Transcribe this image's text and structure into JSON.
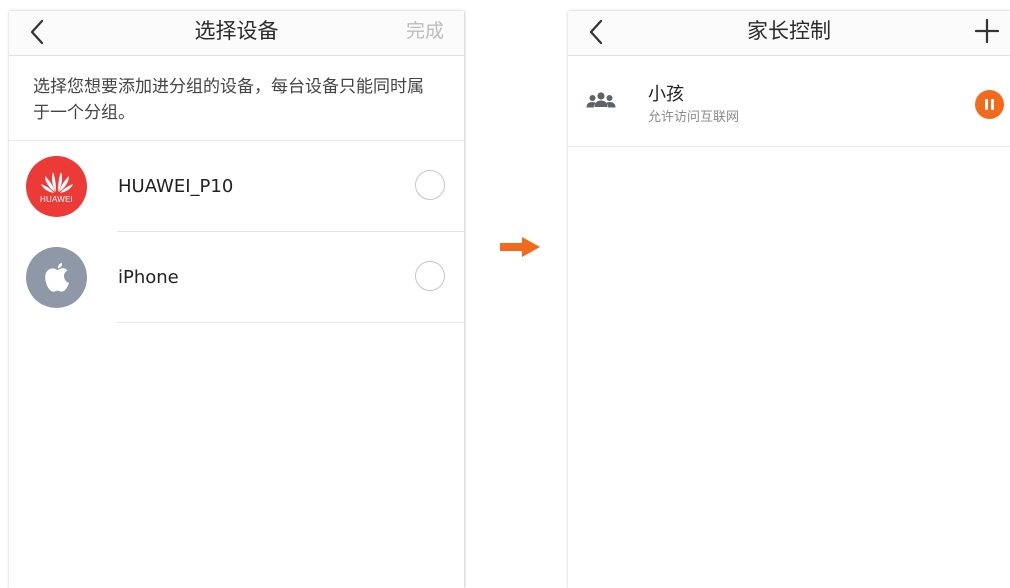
{
  "left_screen": {
    "title": "选择设备",
    "done_label": "完成",
    "hint": "选择您想要添加进分组的设备，每台设备只能同时属于一个分组。",
    "devices": [
      {
        "name": "HUAWEI_P10",
        "icon": "huawei-logo-icon",
        "brand_text": "HUAWEI",
        "selected": false
      },
      {
        "name": "iPhone",
        "icon": "apple-logo-icon",
        "selected": false
      }
    ]
  },
  "arrow": {
    "icon": "right-arrow-icon"
  },
  "right_screen": {
    "title": "家长控制",
    "groups": [
      {
        "name": "小孩",
        "status": "允许访问互联网",
        "icon": "group-people-icon",
        "action_icon": "pause-icon"
      }
    ]
  },
  "colors": {
    "accent_orange": "#f26b1d",
    "huawei_red": "#ec3a37",
    "apple_gray": "#8e98a7",
    "disabled_text": "#bcbcbc"
  }
}
